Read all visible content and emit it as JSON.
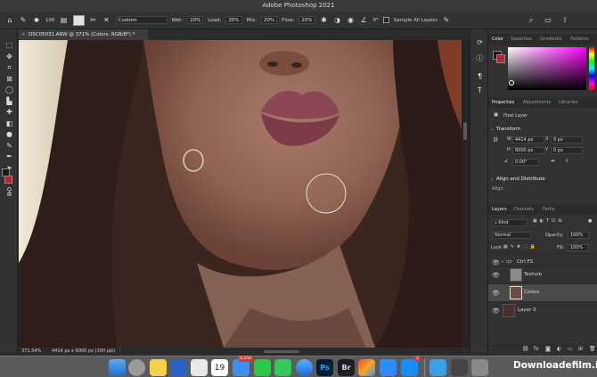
{
  "app": {
    "title": "Adobe Photoshop 2021"
  },
  "options": {
    "brush_size": "100",
    "preset": "Custom",
    "wet_label": "Wet:",
    "wet_val": "20%",
    "load_label": "Load:",
    "load_val": "20%",
    "mix_label": "Mix:",
    "mix_val": "20%",
    "flow_label": "Flow:",
    "flow_val": "20%",
    "angle_val": "0°",
    "sample_all": "Sample All Layers"
  },
  "document": {
    "tab_title": "DSC05031.ARW @ 371% (Colors, RGB/8*) *"
  },
  "status": {
    "zoom": "371.34%",
    "dims": "4414 px x 6000 px (300 ppi)"
  },
  "color_panel": {
    "tabs": [
      "Color",
      "Swatches",
      "Gradients",
      "Patterns"
    ],
    "fg": "#1c1c1c",
    "bg": "#b3262d"
  },
  "properties": {
    "tabs": [
      "Properties",
      "Adjustments",
      "Libraries"
    ],
    "type": "Pixel Layer",
    "transform_title": "Transform",
    "w_label": "W",
    "w": "4414 px",
    "h_label": "H",
    "h": "6000 px",
    "x_label": "X",
    "x": "0 px",
    "y_label": "Y",
    "y": "0 px",
    "angle": "0.00°",
    "align_title": "Align and Distribute",
    "align_label": "Align:"
  },
  "layers_panel": {
    "tabs": [
      "Layers",
      "Channels",
      "Paths"
    ],
    "filter": "Kind",
    "blend": "Normal",
    "opacity_label": "Opacity:",
    "opacity": "100%",
    "lock_label": "Lock:",
    "fill_label": "Fill:",
    "fill": "100%",
    "layers": [
      {
        "name": "Ctrl FS"
      },
      {
        "name": "Texture"
      },
      {
        "name": "Colors"
      },
      {
        "name": "Layer 0"
      }
    ]
  },
  "dock": {
    "calendar_date": "19",
    "mail_badge": "9,254",
    "appstore_badge": "2"
  },
  "watermark": "Downloadefilm.ir"
}
